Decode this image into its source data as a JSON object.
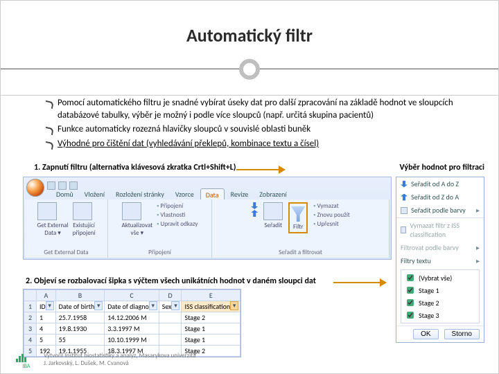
{
  "title": "Automatický filtr",
  "bullets": {
    "b1": "Pomocí automatického filtru je snadné vybírat úseky dat pro další zpracování na základě hodnot ve sloupcích databázové tabulky, výběr je možný i podle více sloupců (např. určitá skupina pacientů)",
    "b2": "Funkce automaticky rozezná hlavičky sloupců v souvislé oblasti buněk",
    "b3": "Výhodné pro čištění dat (vyhledávání překlepů, kombinace textu a čísel)"
  },
  "step1": "1. Zapnutí filtru (alternativa klávesová zkratka Crtl+Shift+L)",
  "rightlabel": "Výběr hodnot pro filtraci",
  "ribbon": {
    "tabs": [
      "Domů",
      "Vložení",
      "Rozložení stránky",
      "Vzorce",
      "Data",
      "Revize",
      "Zobrazení"
    ],
    "group1": {
      "a": "Get External\nData ▾",
      "b": "Existující\npřipojení",
      "cap": "Get External Data"
    },
    "group2": {
      "a": "Aktualizovat\nvše ▾",
      "links": [
        "Připojení",
        "Vlastnosti",
        "Upravit odkazy"
      ],
      "cap": "Připojení"
    },
    "group3": {
      "sort": "Seřadit",
      "filter": "Filtr",
      "links": [
        "Vymazat",
        "Znovu použít",
        "Upřesnit"
      ],
      "cap": "Seřadit a filtrovat"
    }
  },
  "step2": "2. Objeví se rozbalovací šipka s výčtem všech unikátních hodnot v daném sloupci dat",
  "sheet": {
    "cols": [
      "",
      "A",
      "B",
      "C",
      "D",
      "E"
    ],
    "headers": [
      "ID",
      "Date of birth",
      "Date of diagno",
      "Sex",
      "ISS classification"
    ],
    "rows": [
      [
        "2",
        "1",
        "25.7.1958",
        "14.12.2006 M",
        "Stage 2"
      ],
      [
        "3",
        "4",
        "19.8.1930",
        "3.3.1997 M",
        "Stage 1"
      ],
      [
        "4",
        "5",
        "55",
        "10.10.1999 M",
        "Stage 1"
      ],
      [
        "5",
        "192",
        "19.1.1955",
        "18.3.1997 M",
        "Stage 2"
      ]
    ]
  },
  "dropdown": {
    "sortAZ": "Seřadit od A do Z",
    "sortZA": "Seřadit od Z do A",
    "byColor": "Seřadit podle barvy",
    "clear": "Vymazat filtr z ISS classification",
    "filterColor": "Filtrovat podle barvy",
    "textFilters": "Filtry textu",
    "opts": [
      "(Vybrat vše)",
      "Stage 1",
      "Stage 2",
      "Stage 3"
    ],
    "ok": "OK",
    "cancel": "Storno"
  },
  "footer": {
    "l1": "Vytvořil Institut biostatistiky a analýz, Masarykova univerzita",
    "l2": "J. Jarkovský, L. Dušek, M. Cvanová"
  },
  "iba": "IBA"
}
